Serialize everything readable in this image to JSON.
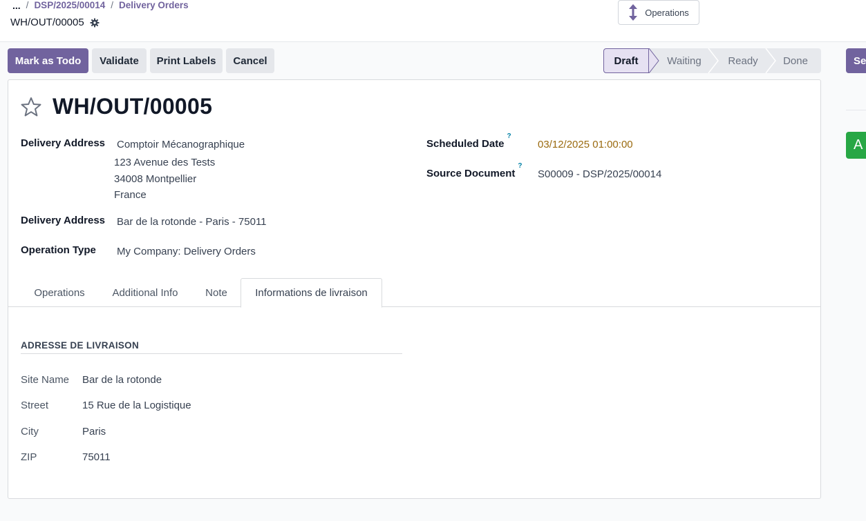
{
  "breadcrumb": {
    "dots": "...",
    "items": [
      "DSP/2025/00014",
      "Delivery Orders"
    ]
  },
  "record": {
    "reference": "WH/OUT/00005",
    "title": "WH/OUT/00005"
  },
  "operations_button": {
    "label": "Operations",
    "icon": "up-down-arrows-icon"
  },
  "actions": {
    "mark_todo": "Mark as Todo",
    "validate": "Validate",
    "print_labels": "Print Labels",
    "cancel": "Cancel"
  },
  "statusbar": {
    "stages": [
      "Draft",
      "Waiting",
      "Ready",
      "Done"
    ],
    "active": "Draft"
  },
  "side": {
    "button_label": "Se",
    "green_label": "A"
  },
  "fields": {
    "delivery_address_label": "Delivery Address",
    "delivery_address_name": "Comptoir Mécanographique",
    "delivery_address_lines": [
      "123 Avenue des Tests",
      "34008 Montpellier",
      "France"
    ],
    "delivery_address2_label": "Delivery Address",
    "delivery_address2_value": "Bar de la rotonde - Paris - 75011",
    "operation_type_label": "Operation Type",
    "operation_type_value": "My Company: Delivery Orders",
    "scheduled_date_label": "Scheduled Date",
    "scheduled_date_value": "03/12/2025 01:00:00",
    "source_document_label": "Source Document",
    "source_document_value": "S00009 - DSP/2025/00014",
    "help_mark": "?"
  },
  "tabs": [
    "Operations",
    "Additional Info",
    "Note",
    "Informations de livraison"
  ],
  "active_tab": "Informations de livraison",
  "delivery_info": {
    "section_title": "ADRESSE DE LIVRAISON",
    "rows": [
      {
        "label": "Site Name",
        "value": "Bar de la rotonde"
      },
      {
        "label": "Street",
        "value": "15 Rue de la Logistique"
      },
      {
        "label": "City",
        "value": "Paris"
      },
      {
        "label": "ZIP",
        "value": "75011"
      }
    ]
  },
  "colors": {
    "primary": "#71639e",
    "date": "#9a6a0f",
    "help": "#0180a5",
    "green": "#28a745"
  }
}
